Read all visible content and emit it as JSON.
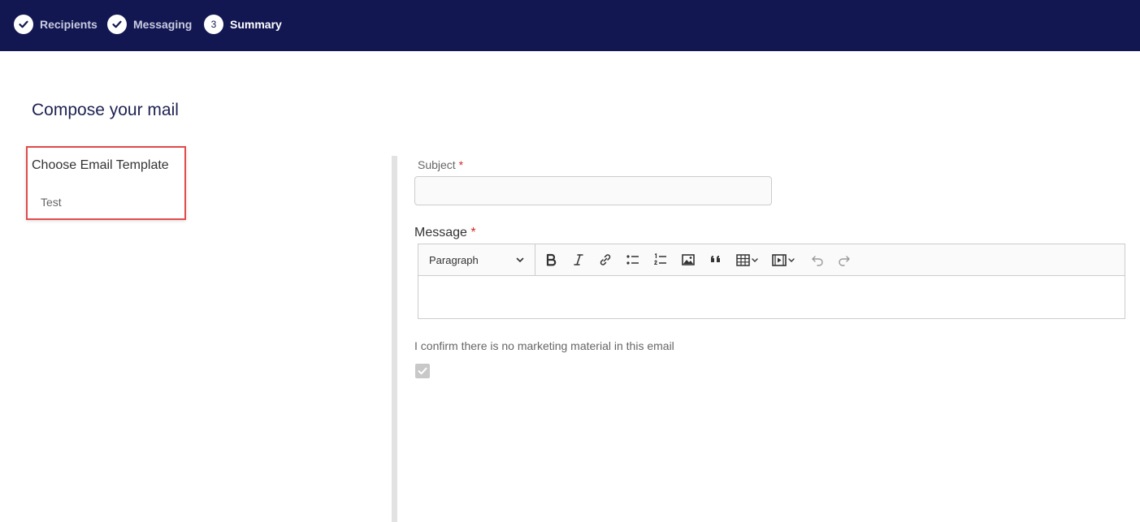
{
  "stepper": {
    "steps": [
      {
        "label": "Recipients",
        "state": "complete",
        "icon": "check-icon"
      },
      {
        "label": "Messaging",
        "state": "complete",
        "icon": "check-icon"
      },
      {
        "label": "Summary",
        "state": "active",
        "number": "3"
      }
    ]
  },
  "page": {
    "title": "Compose your mail"
  },
  "template_chooser": {
    "heading": "Choose Email Template",
    "items": [
      {
        "label": "Test"
      }
    ]
  },
  "form": {
    "subject_label": "Subject",
    "subject_value": "",
    "message_label": "Message",
    "required_mark": "*",
    "confirm_label": "I confirm there is no marketing material in this email",
    "confirm_checked": true
  },
  "editor": {
    "heading_select": "Paragraph",
    "toolbar_icons": [
      "bold-icon",
      "italic-icon",
      "link-icon",
      "bulleted-list-icon",
      "numbered-list-icon",
      "image-icon",
      "blockquote-icon",
      "table-icon",
      "media-icon",
      "undo-icon",
      "redo-icon"
    ]
  },
  "colors": {
    "topbar": "#121752",
    "title": "#1e2152",
    "highlight_border": "#e14b4b",
    "required": "#d62828"
  }
}
